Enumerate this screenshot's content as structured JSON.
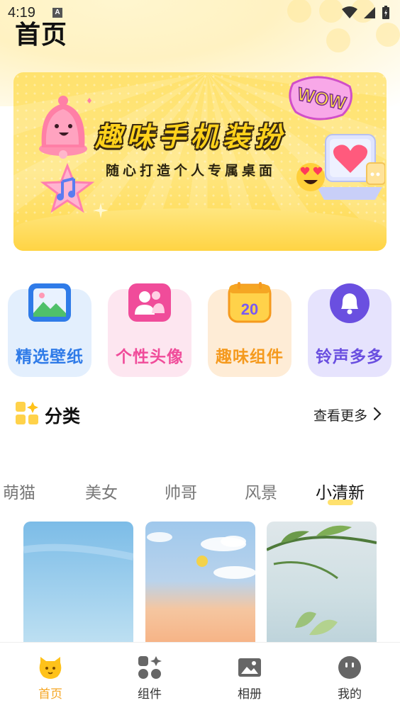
{
  "status_bar": {
    "time": "4:19",
    "notif_badge": "A"
  },
  "page_title": "首页",
  "banner": {
    "title": "趣味手机装扮",
    "subtitle": "随心打造个人专属桌面",
    "sticker_text": "WOW"
  },
  "features": [
    {
      "label": "精选壁纸",
      "icon": "wallpaper-icon",
      "color": "#2f7be8",
      "bg": "#e3effd"
    },
    {
      "label": "个性头像",
      "icon": "avatar-icon",
      "color": "#f04c9a",
      "bg": "#fde6f0"
    },
    {
      "label": "趣味组件",
      "icon": "calendar-widget-icon",
      "color": "#f59a1e",
      "bg": "#feecd6",
      "badge": "20"
    },
    {
      "label": "铃声多多",
      "icon": "bell-icon",
      "color": "#6a4fe0",
      "bg": "#e6e3fd"
    }
  ],
  "category": {
    "title": "分类",
    "more_label": "查看更多"
  },
  "tabs": [
    {
      "label": "萌猫",
      "active": false
    },
    {
      "label": "美女",
      "active": false
    },
    {
      "label": "帅哥",
      "active": false
    },
    {
      "label": "风景",
      "active": false
    },
    {
      "label": "小清新",
      "active": true
    }
  ],
  "bottom_nav": [
    {
      "label": "首页",
      "icon": "cat-home-icon",
      "active": true
    },
    {
      "label": "组件",
      "icon": "widgets-icon",
      "active": false
    },
    {
      "label": "相册",
      "icon": "photo-album-icon",
      "active": false
    },
    {
      "label": "我的",
      "icon": "profile-face-icon",
      "active": false
    }
  ],
  "colors": {
    "accent": "#f5a623",
    "banner_yellow": "#ffe26e"
  }
}
